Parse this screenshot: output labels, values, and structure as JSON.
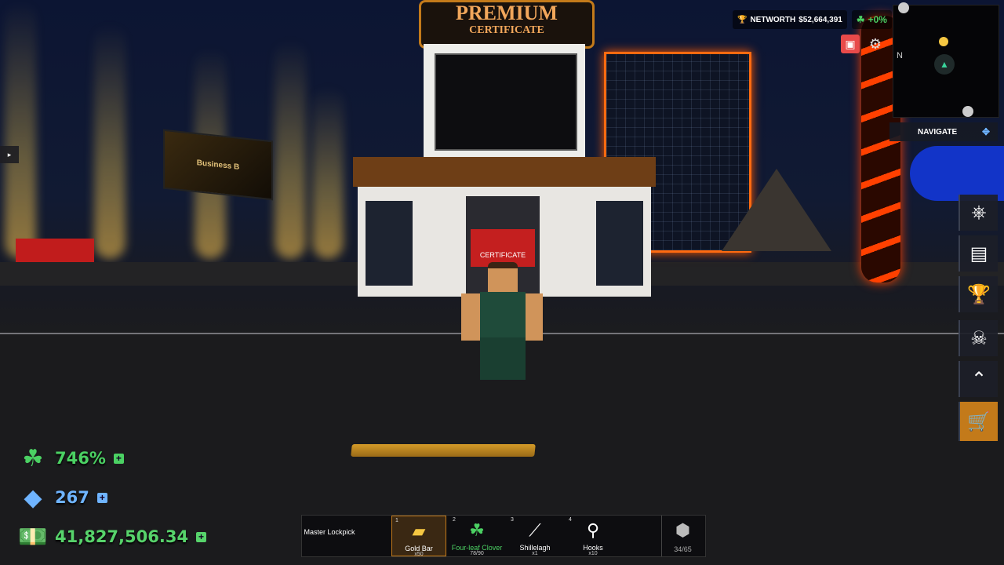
{
  "game": {
    "networth_label": "NETWORTH",
    "networth_value": "$52,664,391",
    "luck_change": "+0%"
  },
  "store_sign": {
    "title": "PREMIUM",
    "subtitle": "CERTIFICATE",
    "door_sign": "CERTIFICATE",
    "billboard": "Business B"
  },
  "minimap": {
    "north_label": "N",
    "navigate_label": "NAVIGATE"
  },
  "stats": {
    "luck": "746%",
    "gems": "267",
    "cash": "41,827,506.34"
  },
  "hotbar": {
    "slots": [
      {
        "name": "Master Lockpick",
        "num": "",
        "qty": ""
      },
      {
        "name": "Gold Bar",
        "num": "1",
        "qty": "x50"
      },
      {
        "name": "Four-leaf Clover",
        "num": "2",
        "qty": "78/90"
      },
      {
        "name": "Shillelagh",
        "num": "3",
        "qty": "x1"
      },
      {
        "name": "Hooks",
        "num": "4",
        "qty": "x10"
      }
    ],
    "inventory_count": "34/65"
  },
  "colors": {
    "luck_green": "#4bd163",
    "gem_blue": "#6fb4ff",
    "cash_green": "#57d36b",
    "accent_orange": "#c37a1a"
  }
}
